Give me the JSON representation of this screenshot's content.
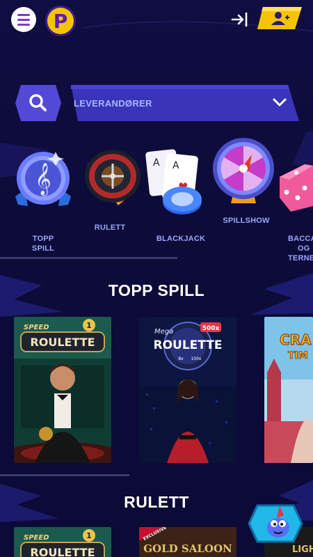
{
  "search": {
    "provider_label": "LEVERANDØRER"
  },
  "categories": [
    {
      "label_lines": [
        "TOPP",
        "SPILL"
      ]
    },
    {
      "label_lines": [
        "RULETT"
      ]
    },
    {
      "label_lines": [
        "BLACKJACK"
      ]
    },
    {
      "label_lines": [
        "SPILLSHOW"
      ]
    },
    {
      "label_lines": [
        "BACCA",
        "OG",
        "TERNE"
      ]
    }
  ],
  "sections": [
    {
      "title": "TOPP SPILL"
    },
    {
      "title": "RULETT"
    }
  ],
  "games": {
    "speed_roulette": {
      "brand": "SPEED",
      "name": "ROULETTE",
      "badge": "1"
    },
    "mega_roulette": {
      "brand": "Mega",
      "name": "ROULETTE",
      "multiplier": "500x",
      "mini1": "8x",
      "mini2": "100x"
    },
    "crazy_time": {
      "part1": "CRA",
      "part2": "TIM"
    },
    "gold_saloon": {
      "tag": "EXCLUSIVE",
      "name": "GOLD SALOON"
    },
    "lightning": {
      "name": "LIGHT"
    }
  },
  "colors": {
    "background": "#0d0b3a",
    "accent": "#4b3fc9",
    "label": "#9aa6ff",
    "register": "#f5c400"
  },
  "icons": [
    "menu-icon",
    "logo-p-icon",
    "login-icon",
    "register-user-icon",
    "search-icon",
    "chevron-down-icon",
    "chat-mascot-icon"
  ]
}
